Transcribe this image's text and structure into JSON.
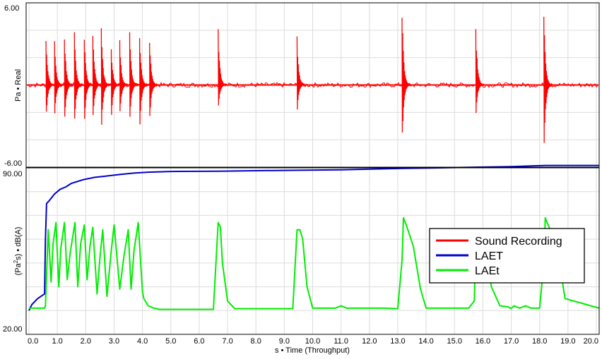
{
  "chart_data": [
    {
      "type": "line",
      "panel": "top",
      "ylabel": "Pa • Real",
      "ylim": [
        -6.0,
        6.0
      ],
      "y_ticks": [
        "6.00",
        "-6.00"
      ],
      "xlim": [
        -0.1,
        20.1
      ],
      "grid": true,
      "series": [
        {
          "name": "Sound Recording",
          "color": "#ff0000",
          "baseline": 0.0,
          "spikes": [
            {
              "x": 0.65,
              "up": 3.6,
              "down": -2.8
            },
            {
              "x": 0.95,
              "up": 3.3,
              "down": -2.7
            },
            {
              "x": 1.3,
              "up": 3.9,
              "down": -3.3
            },
            {
              "x": 1.65,
              "up": 4.0,
              "down": -3.2
            },
            {
              "x": 2.0,
              "up": 3.7,
              "down": -3.1
            },
            {
              "x": 2.3,
              "up": 4.1,
              "down": -3.1
            },
            {
              "x": 2.6,
              "up": 4.3,
              "down": -3.6
            },
            {
              "x": 2.95,
              "up": 2.8,
              "down": -2.8
            },
            {
              "x": 3.25,
              "up": 3.3,
              "down": -2.6
            },
            {
              "x": 3.6,
              "up": 3.9,
              "down": -3.0
            },
            {
              "x": 3.95,
              "up": 3.9,
              "down": -3.6
            },
            {
              "x": 4.3,
              "up": 3.6,
              "down": -3.0
            },
            {
              "x": 6.72,
              "up": 4.1,
              "down": -2.0
            },
            {
              "x": 9.5,
              "up": 3.6,
              "down": -2.2
            },
            {
              "x": 13.2,
              "up": 5.7,
              "down": -4.9
            },
            {
              "x": 15.8,
              "up": 4.4,
              "down": -2.5
            },
            {
              "x": 18.2,
              "up": 5.5,
              "down": -5.4
            }
          ]
        }
      ]
    },
    {
      "type": "line",
      "panel": "bottom",
      "ylabel": "(Pa²s) • dB(A)",
      "ylabel_parts": {
        "open": "(Pa",
        "sup": "2",
        "close": "s) • dB(A)"
      },
      "xlabel": "s • Time (Throughput)",
      "ylim": [
        20.0,
        90.0
      ],
      "y_ticks": [
        "90.00",
        "20.00"
      ],
      "xlim": [
        -0.1,
        20.1
      ],
      "x_ticks": [
        "0.0",
        "1.0",
        "2.0",
        "3.0",
        "4.0",
        "5.0",
        "6.0",
        "7.0",
        "8.0",
        "9.0",
        "10.0",
        "11.0",
        "12.0",
        "13.0",
        "14.0",
        "15.0",
        "16.0",
        "17.0",
        "18.0",
        "19.0",
        "20.0"
      ],
      "grid": true,
      "series": [
        {
          "name": "LAET",
          "color": "#0000cc",
          "x": [
            0.0,
            0.1,
            0.3,
            0.55,
            0.58,
            0.62,
            0.7,
            0.9,
            1.1,
            1.3,
            1.5,
            1.9,
            2.3,
            2.7,
            3.2,
            3.7,
            4.2,
            5.0,
            6.7,
            8.0,
            9.5,
            11.0,
            13.2,
            14.5,
            15.8,
            17.0,
            18.2,
            20.1
          ],
          "y": [
            30.0,
            32.5,
            35.0,
            37.0,
            60.0,
            75.0,
            76.0,
            79.0,
            81.0,
            82.0,
            83.5,
            85.0,
            86.0,
            86.5,
            87.2,
            87.8,
            88.2,
            88.5,
            88.6,
            88.8,
            89.0,
            89.2,
            89.8,
            90.0,
            90.3,
            90.5,
            91.0,
            91.0
          ]
        },
        {
          "name": "LAEt",
          "color": "#00ee00",
          "x": [
            0.0,
            0.55,
            0.58,
            0.68,
            0.78,
            0.85,
            0.95,
            1.05,
            1.12,
            1.25,
            1.35,
            1.45,
            1.62,
            1.72,
            1.82,
            1.95,
            2.05,
            2.15,
            2.25,
            2.4,
            2.5,
            2.6,
            2.75,
            2.9,
            3.0,
            3.2,
            3.35,
            3.5,
            3.6,
            3.7,
            3.85,
            4.0,
            4.05,
            4.2,
            4.4,
            4.6,
            5.0,
            6.5,
            6.67,
            6.75,
            6.82,
            7.0,
            7.25,
            9.3,
            9.45,
            9.55,
            9.65,
            9.8,
            10.0,
            10.8,
            11.0,
            11.2,
            12.5,
            13.0,
            13.15,
            13.2,
            13.3,
            13.55,
            13.8,
            14.0,
            15.5,
            15.7,
            15.75,
            15.95,
            16.1,
            16.3,
            16.6,
            16.9,
            17.0,
            17.1,
            17.3,
            17.5,
            17.7,
            18.0,
            18.15,
            18.2,
            18.3,
            18.5,
            18.6,
            18.9,
            20.1
          ],
          "y": [
            31.0,
            31.0,
            32.0,
            64.0,
            42.0,
            58.0,
            67.0,
            40.0,
            56.0,
            67.0,
            43.0,
            54.0,
            67.0,
            40.0,
            58.0,
            66.0,
            43.0,
            57.0,
            65.0,
            37.0,
            52.0,
            64.0,
            36.0,
            55.0,
            66.0,
            39.0,
            53.0,
            64.0,
            39.0,
            55.0,
            67.0,
            38.0,
            35.0,
            32.0,
            31.0,
            30.5,
            30.5,
            30.5,
            67.0,
            65.0,
            50.0,
            34.0,
            30.8,
            30.8,
            64.0,
            64.0,
            60.0,
            40.0,
            31.0,
            31.0,
            32.0,
            31.0,
            31.0,
            30.8,
            51.0,
            69.0,
            66.0,
            57.0,
            39.0,
            31.0,
            31.0,
            34.0,
            64.0,
            64.0,
            58.0,
            40.0,
            32.0,
            31.5,
            30.8,
            32.0,
            31.0,
            32.0,
            31.0,
            31.0,
            50.0,
            69.0,
            66.0,
            61.0,
            57.0,
            35.0,
            31.0
          ]
        }
      ],
      "legend": {
        "position": "right",
        "entries": [
          {
            "name": "Sound Recording",
            "color": "#ff0000"
          },
          {
            "name": "LAET",
            "color": "#0000cc"
          },
          {
            "name": "LAEt",
            "color": "#00ee00"
          }
        ]
      }
    }
  ]
}
